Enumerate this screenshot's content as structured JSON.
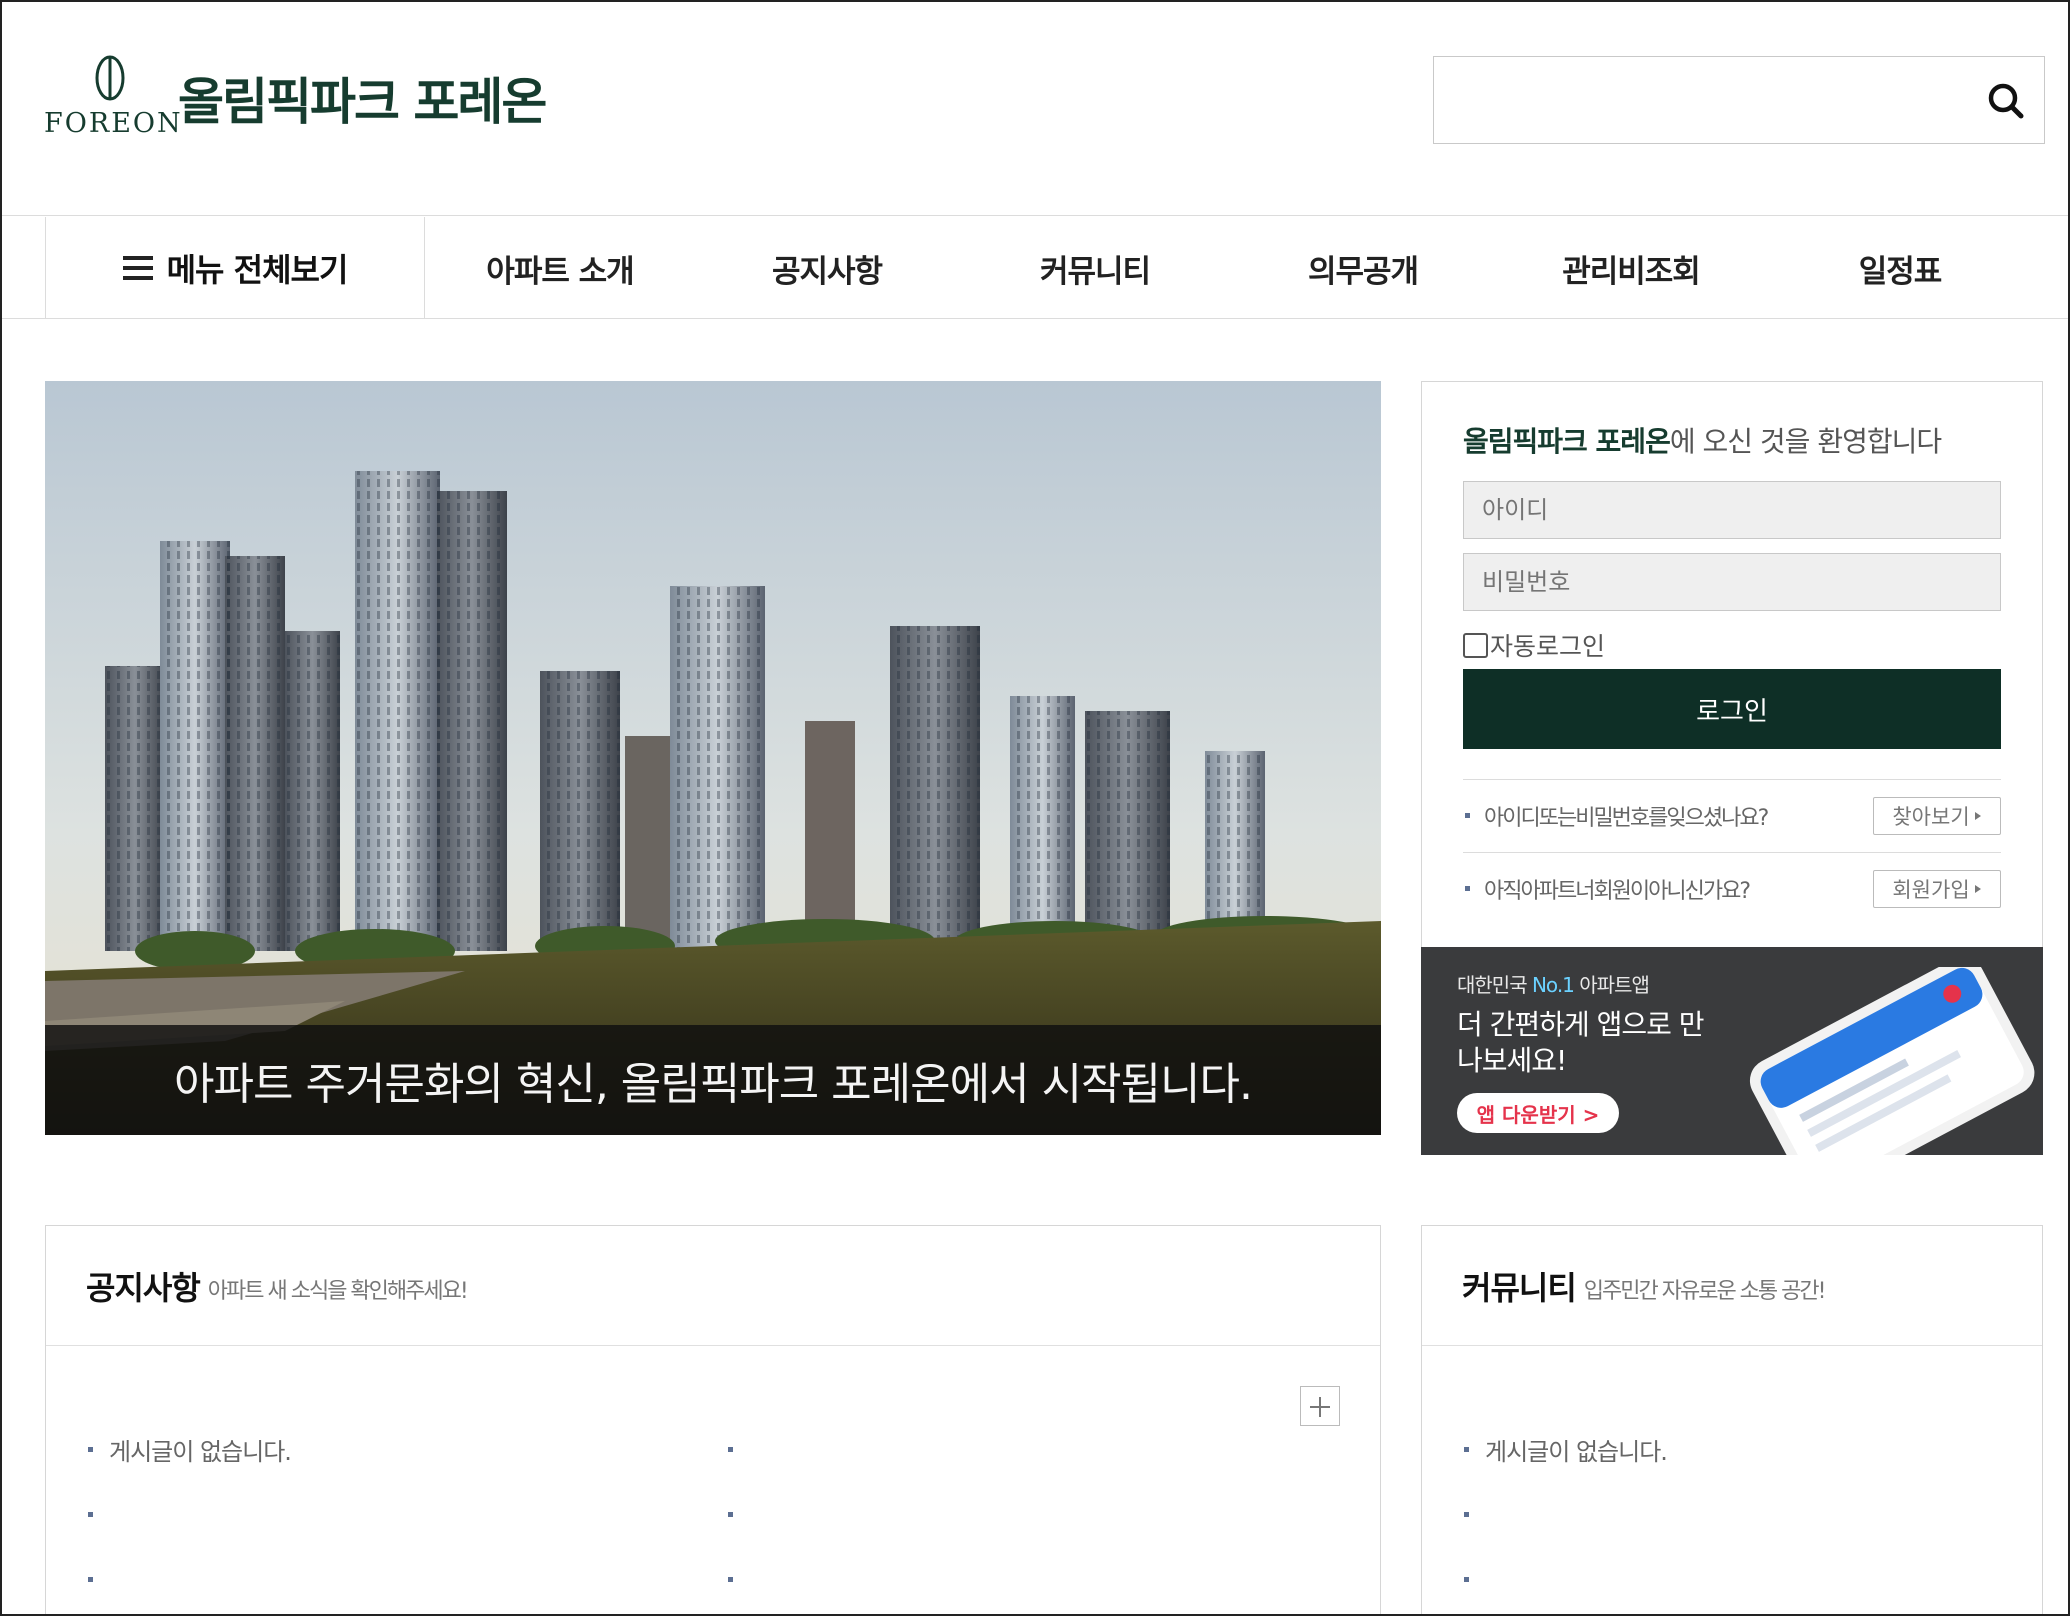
{
  "header": {
    "logo_text": "FOREON",
    "site_name": "올림픽파크 포레온",
    "search_placeholder": ""
  },
  "nav": {
    "all_menu": "메뉴 전체보기",
    "items": [
      "아파트 소개",
      "공지사항",
      "커뮤니티",
      "의무공개",
      "관리비조회",
      "일정표"
    ]
  },
  "hero": {
    "caption": "아파트 주거문화의 혁신, 올림픽파크 포레온에서 시작됩니다."
  },
  "login": {
    "welcome_name": "올림픽파크 포레온",
    "welcome_rest": "에 오신 것을 환영합니다",
    "id_placeholder": "아이디",
    "pw_placeholder": "비밀번호",
    "auto_login": "자동로그인",
    "login_button": "로그인",
    "find_text": "아이디또는비밀번호를잊으셨나요?",
    "find_button": "찾아보기",
    "join_text": "아직아파트너회원이아니신가요?",
    "join_button": "회원가입"
  },
  "app_banner": {
    "line1_pre": "대한민국 ",
    "line1_no1": "No.1",
    "line1_post": " 아파트앱",
    "line2": "더 간편하게 앱으로 만나보세요!",
    "download": "앱 다운받기 >"
  },
  "notice_board": {
    "title": "공지사항",
    "subtitle": "아파트 새 소식을 확인해주세요!",
    "empty": "게시글이 없습니다."
  },
  "community_board": {
    "title": "커뮤니티",
    "subtitle": "입주민간 자유로운 소통 공간!",
    "empty": "게시글이 없습니다."
  },
  "colors": {
    "brand": "#163c2f",
    "login_button": "#0e2f26",
    "bullet": "#5c6f92",
    "app_accent": "#e5334b"
  }
}
